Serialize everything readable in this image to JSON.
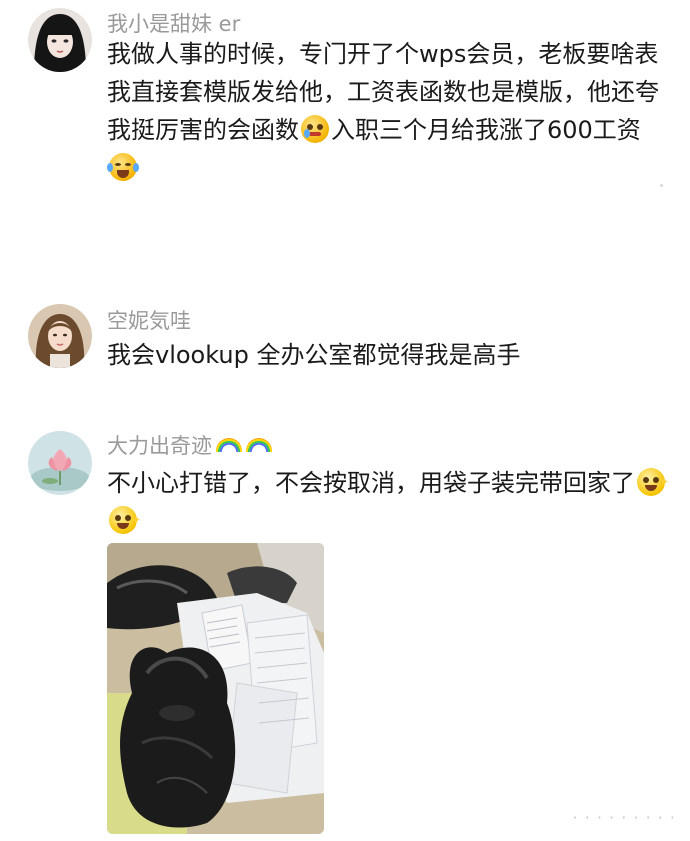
{
  "comments": [
    {
      "username": "我小是甜妹 er",
      "text_parts": [
        "我做人事的时候，专门开了个wps会员，老板要啥表我直接套模版发给他，工资表函数也是模版，他还夸我挺厉害的会函数",
        "入职三个月给我涨了600工资"
      ],
      "emojis": [
        "dizzy-face-emoji",
        "laughing-tears-emoji"
      ]
    },
    {
      "username": "空妮気哇",
      "text": "我会vlookup 全办公室都觉得我是高手"
    },
    {
      "username": "大力出奇迹",
      "username_emojis": [
        "rainbow-emoji",
        "rainbow-emoji"
      ],
      "text": "不小心打错了，不会按取消，用袋子装完带回家了",
      "emojis": [
        "grinning-face-emoji",
        "grinning-face-emoji"
      ],
      "photo_description_icon": "photo-of-black-bag-with-papers"
    }
  ]
}
